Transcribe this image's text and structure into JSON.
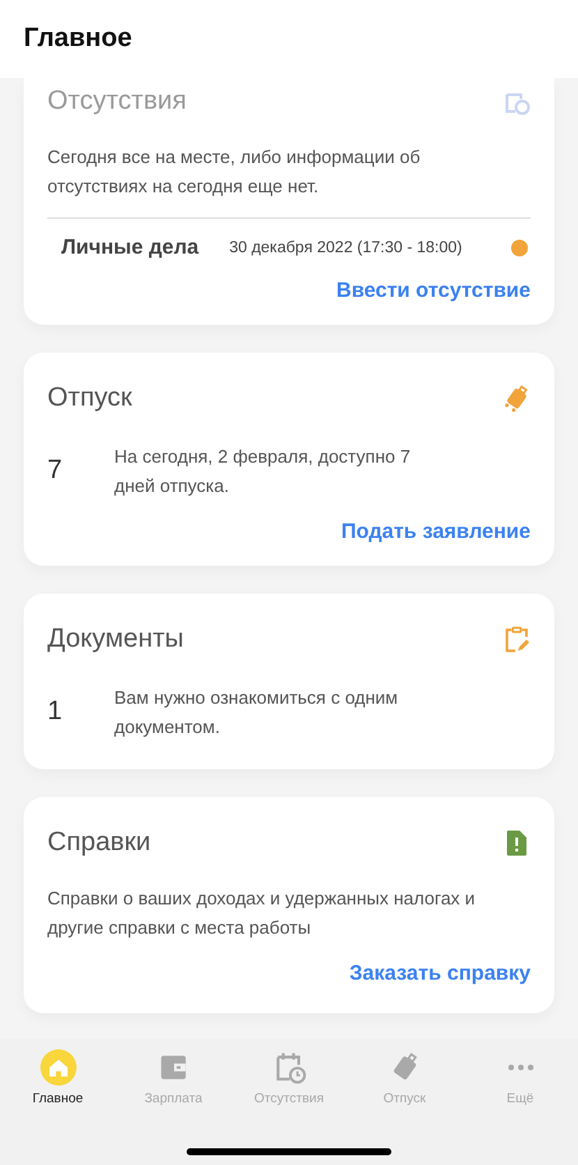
{
  "header": {
    "title": "Главное"
  },
  "cards": [
    {
      "kind": "absences",
      "title": "Отсутствия",
      "text": "Сегодня все на месте, либо информации об отсутствиях на сегодня еще нет.",
      "entries": [
        {
          "type": "Личные дела",
          "date": "30 декабря 2022 (17:30 - 18:00)",
          "color": "#f0a43a"
        }
      ],
      "action": "Ввести отсутствие"
    },
    {
      "kind": "vacation",
      "title": "Отпуск",
      "count": "7",
      "text": "На сегодня, 2 февраля, доступно 7 дней отпуска.",
      "action": "Подать заявление"
    },
    {
      "kind": "documents",
      "title": "Документы",
      "count": "1",
      "text": "Вам нужно ознакомиться с одним документом."
    },
    {
      "kind": "certificates",
      "title": "Справки",
      "text": "Справки о ваших доходах и удержанных налогах и другие справки с места работы",
      "action": "Заказать справку"
    }
  ],
  "tab_bar": [
    {
      "kind": "home",
      "label": "Главное",
      "selected": true
    },
    {
      "kind": "wallet",
      "label": "Зарплата",
      "selected": false
    },
    {
      "kind": "calendar",
      "label": "Отсутствия",
      "selected": false
    },
    {
      "kind": "suitcase",
      "label": "Отпуск",
      "selected": false
    },
    {
      "kind": "more",
      "label": "Ещё",
      "selected": false
    }
  ]
}
